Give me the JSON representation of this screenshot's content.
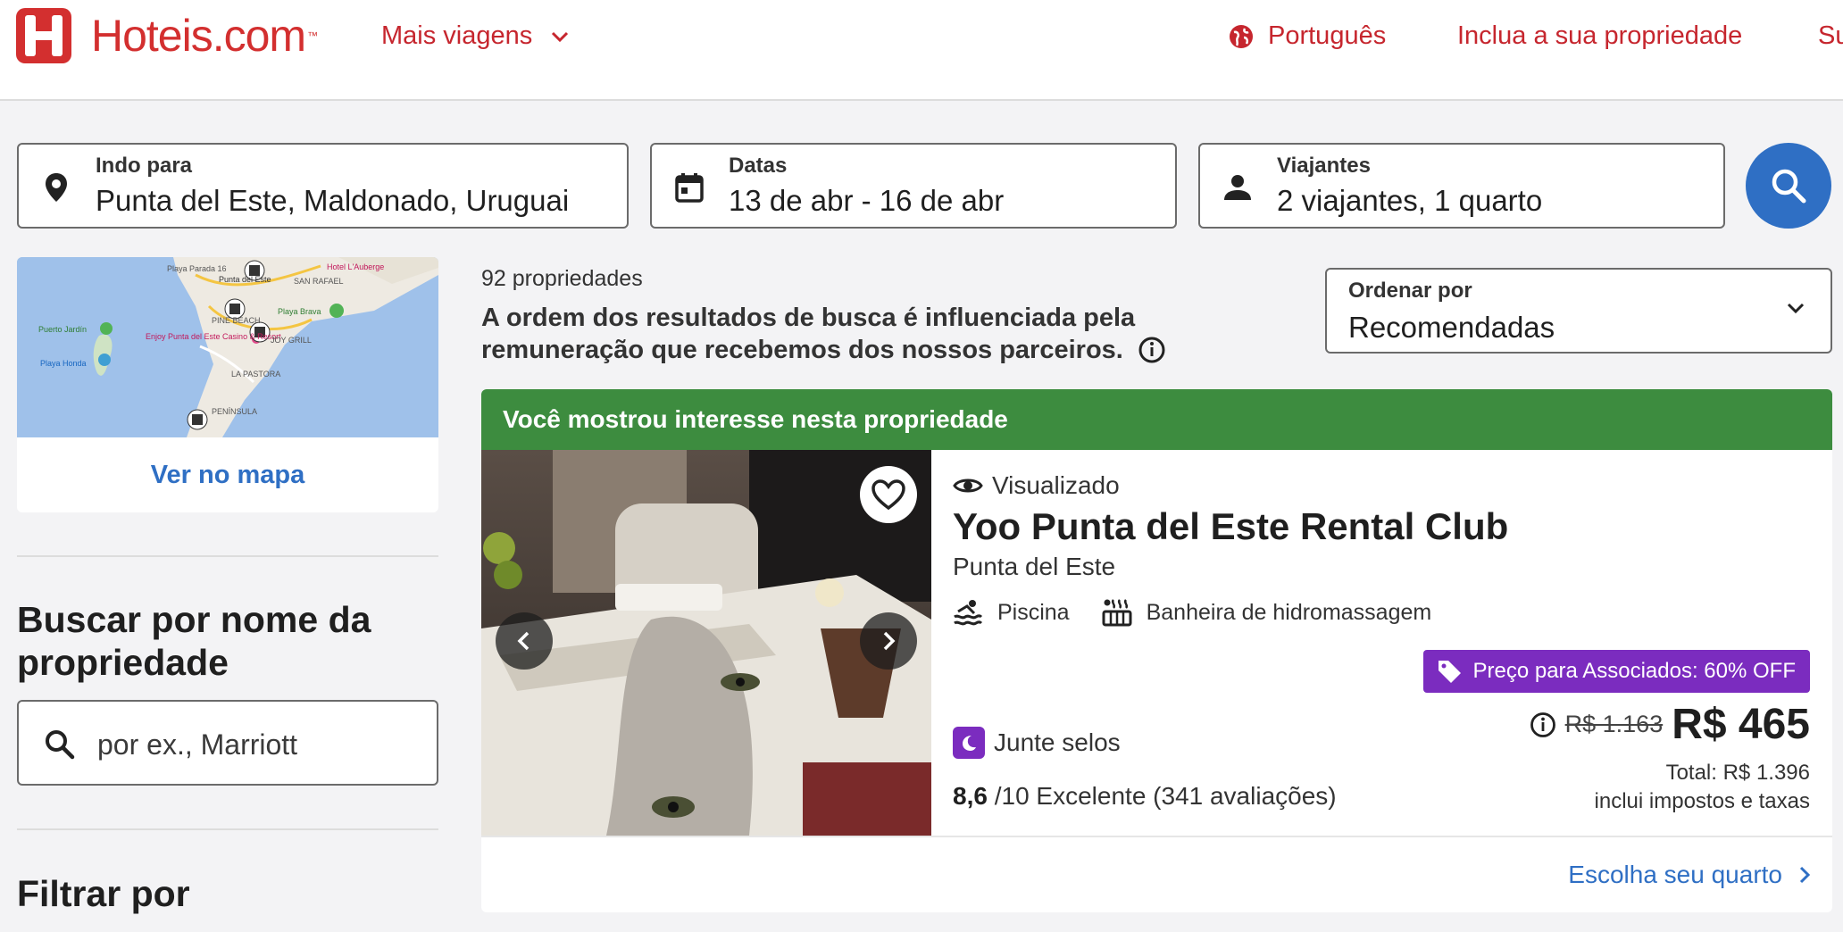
{
  "header": {
    "brand": "Hoteis.com",
    "trademark": "™",
    "more_trips": "Mais viagens",
    "language": "Português",
    "list_property": "Inclua a sua propriedade",
    "signin_partial": "Su"
  },
  "search": {
    "destination_label": "Indo para",
    "destination_value": "Punta del Este, Maldonado, Uruguai",
    "dates_label": "Datas",
    "dates_value": "13 de abr - 16 de abr",
    "travelers_label": "Viajantes",
    "travelers_value": "2 viajantes, 1 quarto"
  },
  "map": {
    "labels": [
      "Playa Parada 16",
      "Punta del Este",
      "Hotel L'Auberge",
      "SAN RAFAEL",
      "PINE BEACH",
      "Playa Brava",
      "Puerto Jardín",
      "Enjoy Punta del Este Casino & Resort",
      "JOY GRILL",
      "Playa Honda",
      "LA PASTORA",
      "PENÍNSULA"
    ],
    "link": "Ver no mapa"
  },
  "name_search": {
    "title": "Buscar por nome da propriedade",
    "placeholder": "por ex., Marriott"
  },
  "filters": {
    "title": "Filtrar por"
  },
  "results": {
    "count": "92 propriedades",
    "disclaimer": "A ordem dos resultados de busca é influenciada pela remuneração que recebemos dos nossos parceiros.",
    "sort_label": "Ordenar por",
    "sort_value": "Recomendadas"
  },
  "property": {
    "banner": "Você mostrou interesse nesta propriedade",
    "viewed": "Visualizado",
    "name": "Yoo Punta del Este Rental Club",
    "location": "Punta del Este",
    "amenities": [
      "Piscina",
      "Banheira de hidromassagem"
    ],
    "member_badge": "Preço para Associados: 60% OFF",
    "stamps": "Junte selos",
    "rating_score": "8,6",
    "rating_text": "/10 Excelente (341 avaliações)",
    "old_price": "R$ 1.163",
    "price": "R$ 465",
    "total": "Total: R$ 1.396",
    "taxes": "inclui impostos e taxas",
    "choose_room": "Escolha seu quarto"
  },
  "colors": {
    "brand_red": "#d32f2f",
    "link_blue": "#2f6fc4",
    "banner_green": "#3d8c3f",
    "member_purple": "#7b2cbf"
  }
}
